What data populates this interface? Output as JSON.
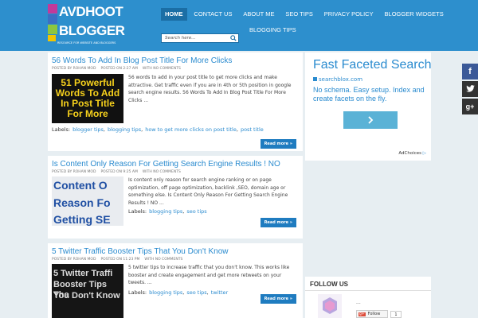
{
  "header": {
    "logo": {
      "line1": "AVDHOOT",
      "line2": "BLOGGER",
      "tagline": "RESOURCE FOR WEBSITE AND BLOGGERS"
    },
    "nav": [
      {
        "label": "HOME",
        "active": true
      },
      {
        "label": "CONTACT US"
      },
      {
        "label": "ABOUT ME"
      },
      {
        "label": "SEO TIPS"
      },
      {
        "label": "PRIVACY POLICY"
      },
      {
        "label": "BLOGGER WIDGETS"
      },
      {
        "label": "BLOGGING TIPS"
      }
    ],
    "search": {
      "placeholder": "Search here..."
    }
  },
  "posts": [
    {
      "title": "56 Words To Add In Blog Post Title For More Clicks",
      "author": "POSTED BY ROHAN MOD",
      "date": "POSTED ON 2:27 AM",
      "comments": "WITH NO COMMENTS",
      "thumb_text": [
        "51 Powerful",
        "Words To Add",
        "In Post Title",
        "For More"
      ],
      "snippet": "56 words to add in your post title to get more clicks and make attractive. Get traffic even if you are in 4th or 5th position in google search engine results. 56 Words To Add In Blog Post Title For More Clicks ...",
      "labels_prefix": "Labels:",
      "labels": [
        "blogger tips",
        "blogging tips",
        "how to get more clicks on post title",
        "post title"
      ],
      "read_more": "Read more »"
    },
    {
      "title": "Is Content Only Reason For Getting Search Engine Results ! NO",
      "author": "POSTED BY ROHAN MOD",
      "date": "POSTED ON 9:25 AM",
      "comments": "WITH NO COMMENTS",
      "thumb_text": [
        "Content O",
        "Reason Fo",
        "Getting SE"
      ],
      "snippet": "Is content only reason for search engine ranking or on page optimization, off page optimization, backlink ,SEO, domain age or something  else. Is Content Only Reason For Getting Search Engine Results ! NO ...",
      "labels_prefix": "Labels:",
      "labels": [
        "blogging tips",
        "seo tips"
      ],
      "read_more": "Read more »"
    },
    {
      "title": "5 Twitter Traffic Booster Tips That You Don't Know",
      "author": "POSTED BY ROHAN MOD",
      "date": "POSTED ON 11:23 PM",
      "comments": "WITH NO COMMENTS",
      "thumb_text": [
        "5 Twitter Traffi",
        "Booster Tips Tha",
        "You Don't Know"
      ],
      "snippet": "5 twitter tips to increase traffic that you don't know. This works like booster and create engagement and get more retweets on your tweets. ...",
      "labels_prefix": "Labels:",
      "labels": [
        "blogging tips",
        "seo tips",
        "twitter"
      ],
      "read_more": "Read more »"
    }
  ],
  "ad": {
    "title": "Fast Faceted Search",
    "url": "searchblox.com",
    "text": "No schema. Easy setup. Index and create facets on the fly.",
    "button_icon": "chevron-right-icon",
    "adchoices": "AdChoices"
  },
  "follow": {
    "title": "FOLLOW US",
    "dots": "...",
    "button_label": "Follow",
    "count": "1"
  },
  "share": [
    {
      "icon": "facebook-icon",
      "glyph": "f",
      "color": "#3b5998"
    },
    {
      "icon": "twitter-icon",
      "glyph": "t",
      "color": "#333333"
    },
    {
      "icon": "google-plus-icon",
      "glyph": "g+",
      "color": "#333333"
    }
  ],
  "colors": {
    "header": "#2d8fcd",
    "nav_active": "#1b6ea5",
    "link": "#2a8bcf",
    "button": "#1f7cc0"
  }
}
